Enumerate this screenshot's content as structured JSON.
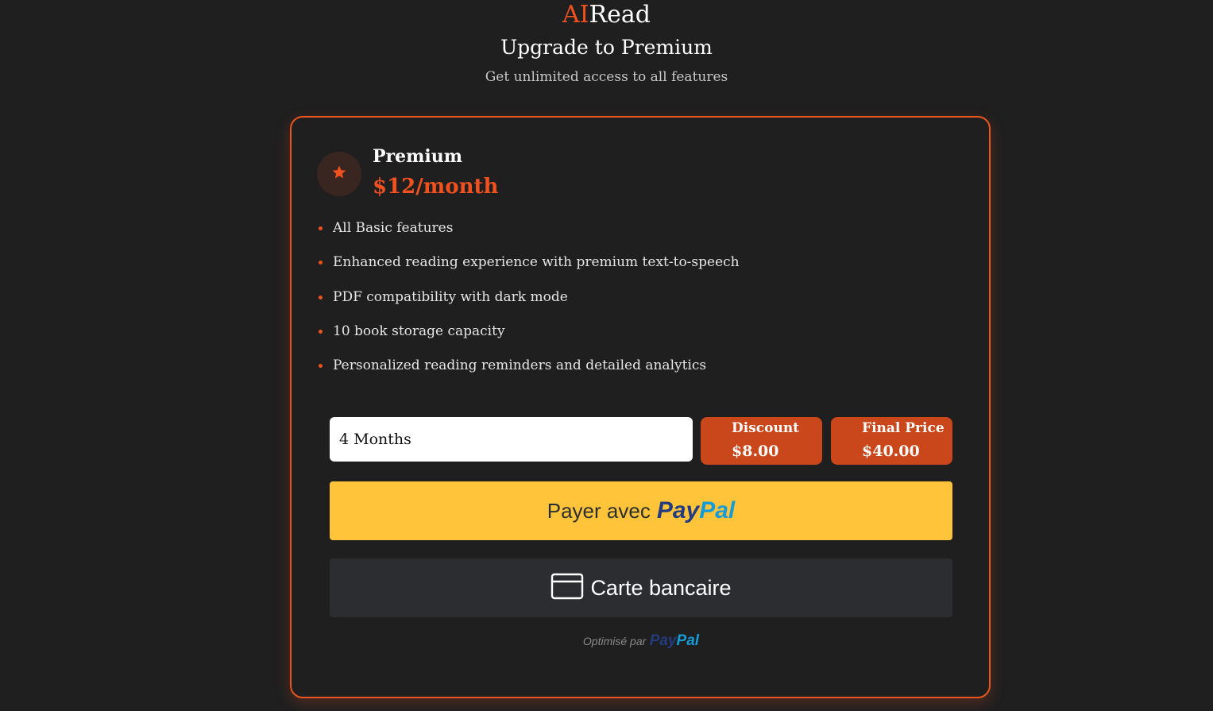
{
  "brand": {
    "prefix": "AI",
    "suffix": "Read"
  },
  "title": "Upgrade to Premium",
  "subtitle": "Get unlimited access to all features",
  "plan": {
    "name": "Premium",
    "price": "$12/month",
    "icon": "star-icon",
    "features": [
      "All Basic features",
      "Enhanced reading experience with premium text-to-speech",
      "PDF compatibility with dark mode",
      "10 book storage capacity",
      "Personalized reading reminders and detailed analytics"
    ]
  },
  "duration": {
    "selected": "4 Months"
  },
  "discount": {
    "label": "Discount",
    "value": "$8.00"
  },
  "final_price": {
    "label": "Final Price",
    "value": "$40.00"
  },
  "paypal_button": {
    "text": "Payer avec",
    "logo_pay": "Pay",
    "logo_pal": "Pal"
  },
  "card_button": {
    "text": "Carte bancaire",
    "icon": "credit-card-icon"
  },
  "powered_by": {
    "text": "Optimisé par",
    "logo_pay": "Pay",
    "logo_pal": "Pal"
  },
  "colors": {
    "accent": "#f0511f",
    "background": "#1f1f20",
    "paypal_yellow": "#ffc43a",
    "price_box": "#c9471a"
  }
}
